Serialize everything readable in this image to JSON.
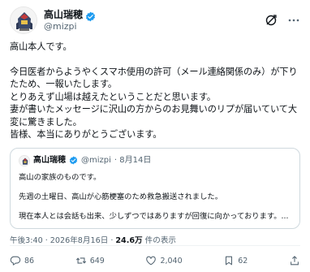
{
  "author": {
    "display_name": "高山瑞穂",
    "handle": "@mizpi"
  },
  "post": {
    "lines": [
      "高山本人です。",
      "",
      "今日医者からようやくスマホ使用の許可（メール連絡関係のみ）が下りたため、一報いたします。",
      "とりあえず山場は越えたということだと思います。",
      "妻が書いたメッセージに沢山の方からのお見舞いのリプが届いていて大変に驚きました。",
      "皆様、本当にありがとうございます。"
    ]
  },
  "quote": {
    "display_name": "高山瑞穂",
    "handle": "@mizpi",
    "date": "· 8月14日",
    "lines": [
      "高山の家族のものです。",
      "",
      "先週の土曜日、高山が心筋梗塞のため救急搬送されました。",
      "",
      "現在本人とは会話も出来、少しずつではありますが回復に向かっております。..."
    ]
  },
  "meta": {
    "time": "午後3:40",
    "date": "2026年8月16日",
    "views": "24.6万",
    "views_suffix": "件の表示"
  },
  "actions": {
    "replies": "86",
    "reposts": "649",
    "likes": "2,040",
    "bookmarks": "62"
  },
  "colors": {
    "verified": "#1d9bf0",
    "muted": "#536471",
    "text": "#0f1419",
    "border": "#cfd9de"
  }
}
